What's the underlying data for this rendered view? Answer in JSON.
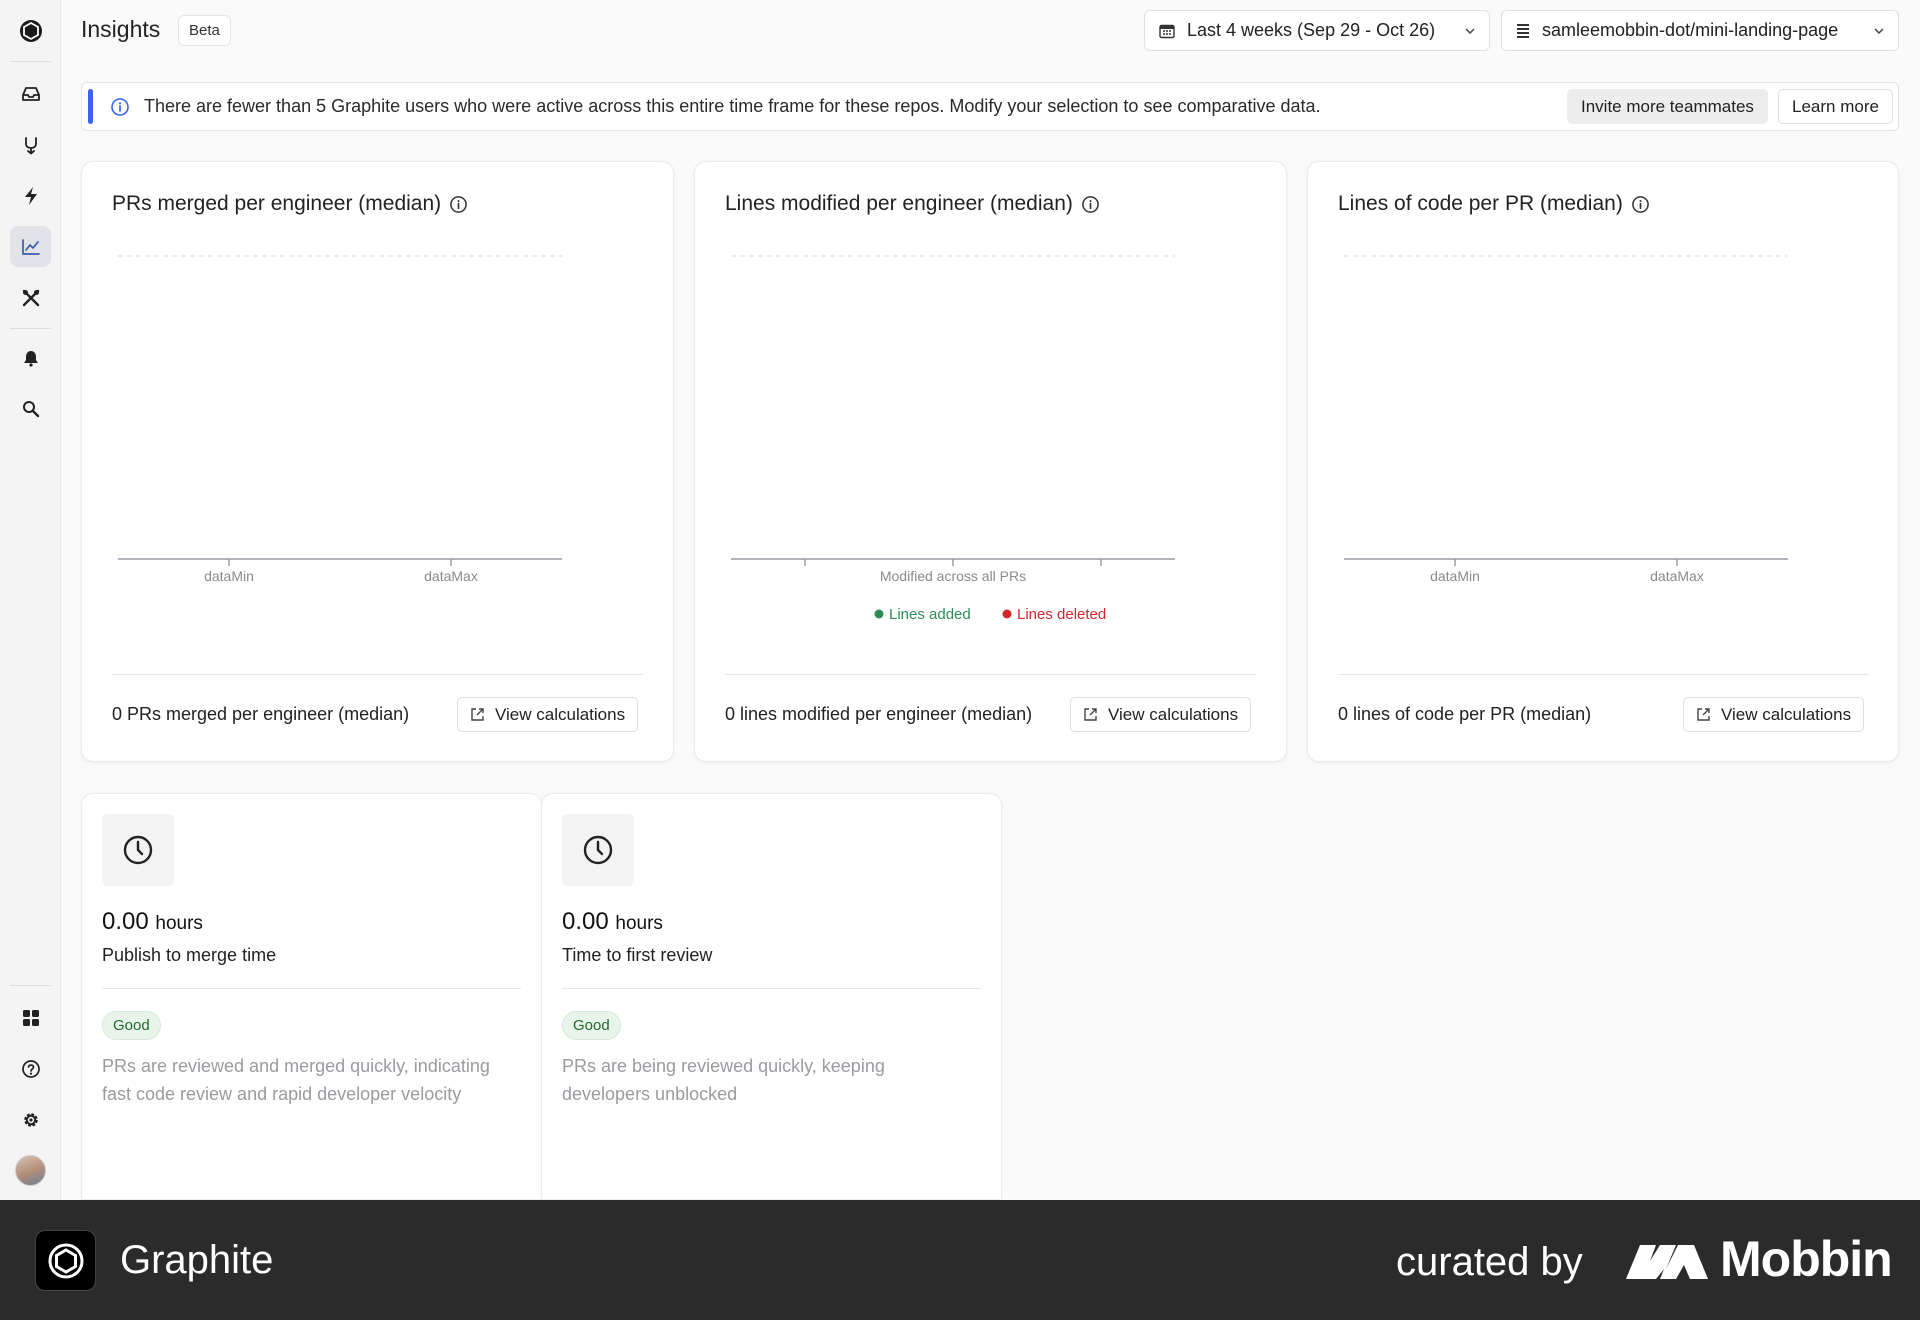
{
  "sidebar": {
    "top_icons": [
      "graphite-logo-icon",
      "inbox-icon",
      "merge-icon",
      "bolt-icon",
      "chart-icon",
      "tools-icon",
      "bell-icon",
      "search-icon"
    ],
    "bottom_icons": [
      "apps-grid-icon",
      "help-icon",
      "gear-icon",
      "avatar"
    ],
    "active": "chart-icon"
  },
  "header": {
    "title": "Insights",
    "badge": "Beta",
    "date_range": "Last 4 weeks (Sep 29 - Oct 26)",
    "repo": "samleemobbin-dot/mini-landing-page"
  },
  "banner": {
    "text": "There are fewer than 5 Graphite users who were active across this entire time frame for these repos. Modify your selection to see comparative data.",
    "primary_button": "Invite more teammates",
    "secondary_button": "Learn more",
    "accent_color": "#3b63f3"
  },
  "charts": [
    {
      "title": "PRs merged per engineer (median)",
      "summary": "0 PRs merged per engineer (median)",
      "button": "View calculations",
      "chart_data": {
        "type": "bar",
        "categories": [],
        "values": [],
        "x_ticks": [
          "dataMin",
          "dataMax"
        ],
        "title": "PRs merged per engineer (median)"
      }
    },
    {
      "title": "Lines modified per engineer (median)",
      "summary": "0 lines modified per engineer (median)",
      "button": "View calculations",
      "chart_data": {
        "type": "bar",
        "categories": [],
        "series": [
          {
            "name": "Lines added",
            "values": [],
            "color": "#2e8b57"
          },
          {
            "name": "Lines deleted",
            "values": [],
            "color": "#d0282f"
          }
        ],
        "xlabel": "Modified across all PRs",
        "legend": "bottom",
        "title": "Lines modified per engineer (median)"
      }
    },
    {
      "title": "Lines of code per PR (median)",
      "summary": "0 lines of code per PR (median)",
      "button": "View calculations",
      "chart_data": {
        "type": "bar",
        "categories": [],
        "values": [],
        "x_ticks": [
          "dataMin",
          "dataMax"
        ],
        "title": "Lines of code per PR (median)"
      }
    }
  ],
  "metrics": [
    {
      "icon": "clock-icon",
      "value": "0.00",
      "unit": "hours",
      "label": "Publish to merge time",
      "badge": "Good",
      "description": "PRs are reviewed and merged quickly, indicating fast code review and rapid developer velocity"
    },
    {
      "icon": "clock-icon",
      "value": "0.00",
      "unit": "hours",
      "label": "Time to first review",
      "badge": "Good",
      "description": "PRs are being reviewed quickly, keeping developers unblocked"
    }
  ],
  "footer": {
    "app_name": "Graphite",
    "curated_by": "curated by",
    "brand": "Mobbin"
  }
}
